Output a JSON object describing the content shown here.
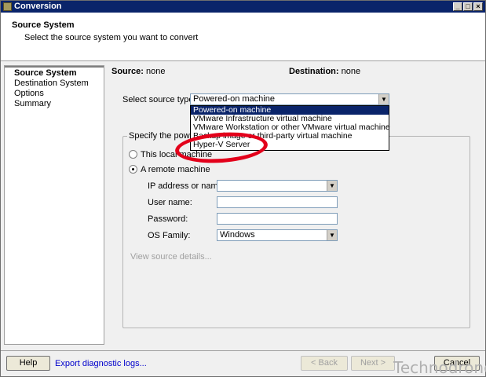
{
  "window": {
    "title": "Conversion"
  },
  "header": {
    "title": "Source System",
    "subtitle": "Select the source system you want to convert"
  },
  "steps": [
    "Source System",
    "Destination System",
    "Options",
    "Summary"
  ],
  "summary": {
    "source_label": "Source:",
    "source_value": "none",
    "dest_label": "Destination:",
    "dest_value": "none"
  },
  "source_type": {
    "label": "Select source type:",
    "value": "Powered-on machine",
    "options": [
      "Powered-on machine",
      "VMware Infrastructure virtual machine",
      "VMware Workstation or other VMware virtual machine",
      "Backup image or third-party virtual machine",
      "Hyper-V Server"
    ]
  },
  "group": {
    "legend": "Specify the powe",
    "local_label": "This local machine",
    "remote_label": "A remote machine",
    "ip_label": "IP address or name:",
    "user_label": "User name:",
    "password_label": "Password:",
    "os_label": "OS Family:",
    "os_value": "Windows",
    "view_details": "View source details..."
  },
  "footer": {
    "help": "Help",
    "export": "Export diagnostic logs...",
    "back": "< Back",
    "next": "Next >",
    "cancel": "Cancel"
  },
  "watermark": "Technodrone",
  "colors": {
    "titlebar": "#0a246a",
    "selected": "#0a246a",
    "highlight_ring": "#e3001b",
    "link": "#0000cc"
  }
}
